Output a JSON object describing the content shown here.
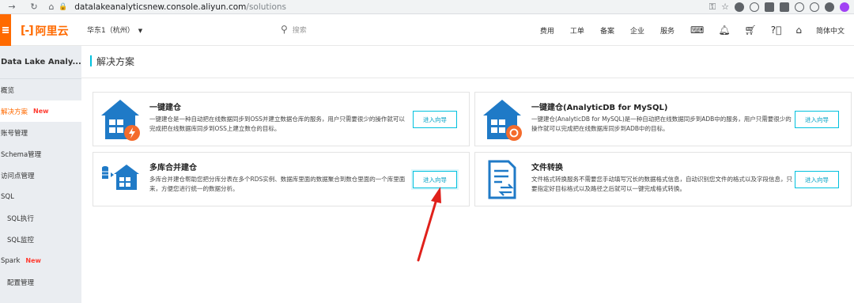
{
  "browser": {
    "url_host": "datalakeanalyticsnew.console.aliyun.com",
    "url_path": "/solutions"
  },
  "topbar": {
    "logo_text": "阿里云",
    "region": "华东1（杭州）",
    "search_placeholder": "搜索",
    "links": [
      "费用",
      "工单",
      "备案",
      "企业",
      "服务"
    ],
    "language": "简体中文"
  },
  "sidebar": {
    "title": "Data Lake Analy...",
    "items": [
      {
        "label": "概览"
      },
      {
        "label": "解决方案",
        "badge": "New"
      },
      {
        "label": "账号管理"
      },
      {
        "label": "Schema管理"
      },
      {
        "label": "访问点管理"
      },
      {
        "label": "SQL"
      },
      {
        "label": "SQL执行"
      },
      {
        "label": "SQL监控"
      },
      {
        "label": "Spark",
        "badge": "New"
      },
      {
        "label": "配置管理"
      }
    ]
  },
  "page": {
    "title": "解决方案"
  },
  "cards": [
    {
      "title": "一键建仓",
      "description": "一键建仓是一种自动把在线数据同步到OSS并建立数据仓库的服务，用户只需要很少的操作就可以完成把在线数据库同步到OSS上建立数仓的目标。",
      "button": "进入向导"
    },
    {
      "title": "一键建仓(AnalyticDB for MySQL)",
      "description": "一键建仓(AnalyticDB for MySQL)是一种自动把在线数据同步到ADB中的服务，用户只需要很少的操作就可以完成把在线数据库同步到ADB中的目标。",
      "button": "进入向导"
    },
    {
      "title": "多库合并建仓",
      "description": "多库合并建仓帮助您把分库分表在多个RDS实例、数据库里面的数据聚合到数仓里面的一个库里面来，方便您进行统一的数据分析。",
      "button": "进入向导"
    },
    {
      "title": "文件转换",
      "description": "文件格式转换服务不需要您手动填写冗长的数据格式信息，自动识别您文件的格式以及字段信息，只要指定好目标格式以及路径之后就可以一键完成格式转换。",
      "button": "进入向导"
    }
  ],
  "colors": {
    "brand": "#ff6a00",
    "accent": "#00c1de",
    "badge": "#ff3b30",
    "icon_blue": "#1f7ac7",
    "icon_orange": "#f46b2c",
    "annotation_arrow": "#e0211b"
  }
}
